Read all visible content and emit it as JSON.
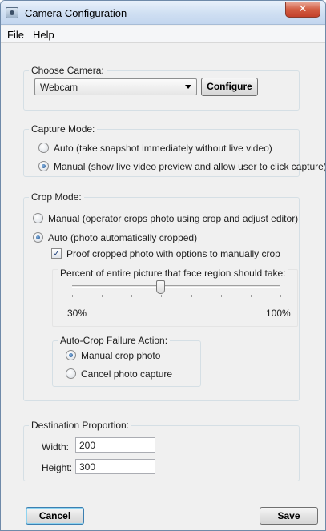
{
  "window": {
    "title": "Camera Configuration",
    "close_glyph": "✕"
  },
  "menu": [
    {
      "label": "File"
    },
    {
      "label": "Help"
    }
  ],
  "choose_camera": {
    "legend": "Choose Camera:",
    "selected": "Webcam",
    "configure_label": "Configure"
  },
  "capture_mode": {
    "legend": "Capture Mode:",
    "options": [
      {
        "label": "Auto (take snapshot immediately without live video)",
        "checked": false
      },
      {
        "label": "Manual (show live video preview and allow user to click capture)",
        "checked": true
      }
    ]
  },
  "crop_mode": {
    "legend": "Crop Mode:",
    "options": [
      {
        "label": "Manual (operator crops photo using crop and adjust editor)",
        "checked": false
      },
      {
        "label": "Auto (photo automatically cropped)",
        "checked": true
      }
    ],
    "proof_label": "Proof cropped photo with options to manually crop",
    "proof_checked": true,
    "face_percent": {
      "label": "Percent of entire picture that face region should take:",
      "min_label": "30%",
      "max_label": "100%",
      "min": 30,
      "max": 100,
      "value": 60
    },
    "failure_action": {
      "legend": "Auto-Crop Failure Action:",
      "options": [
        {
          "label": "Manual crop photo",
          "checked": true
        },
        {
          "label": "Cancel photo capture",
          "checked": false
        }
      ]
    }
  },
  "destination": {
    "legend": "Destination Proportion:",
    "width_label": "Width:",
    "width_value": "200",
    "height_label": "Height:",
    "height_value": "300"
  },
  "footer": {
    "cancel_label": "Cancel",
    "save_label": "Save"
  },
  "colors": {
    "window_bg": "#f0f0f0",
    "close_button": "#c3402a",
    "radio_dot": "#1c4f8c"
  }
}
